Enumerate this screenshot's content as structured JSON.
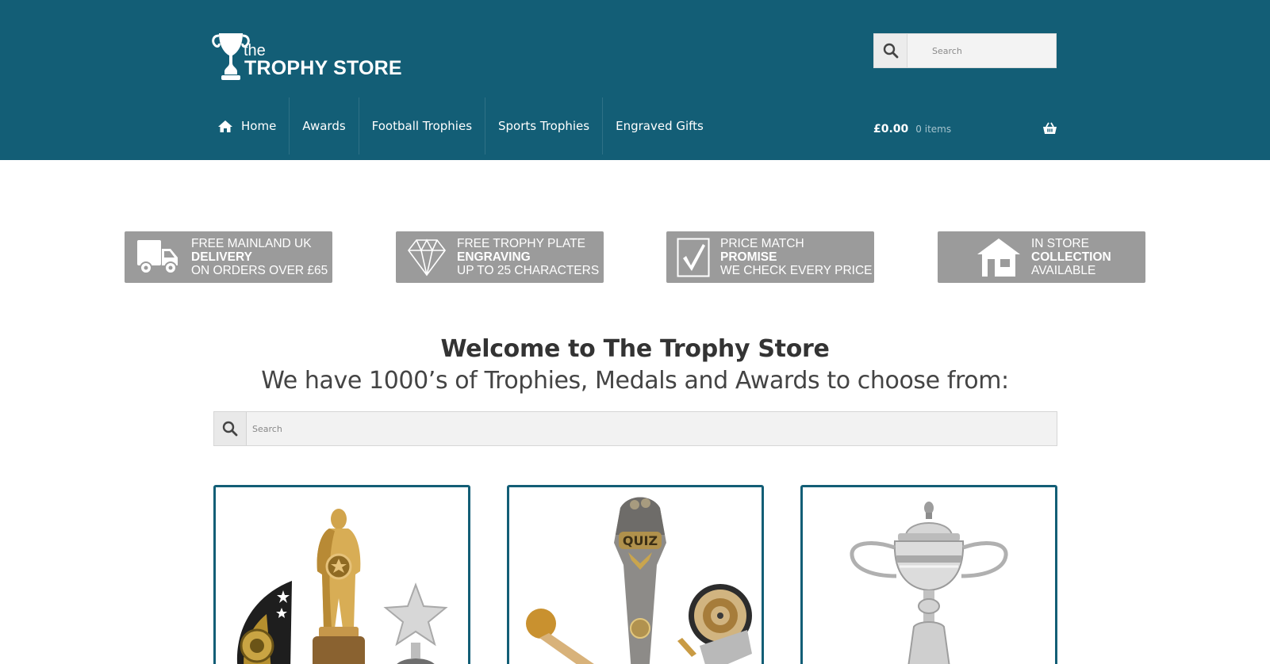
{
  "brand": {
    "logo_the": "the",
    "logo_store": "TROPHY STORE",
    "header_color": "#135e76"
  },
  "header_search": {
    "placeholder": "Search",
    "icon": "search-icon"
  },
  "nav": {
    "home": "Home",
    "awards": "Awards",
    "football": "Football Trophies",
    "sports": "Sports Trophies",
    "engraved": "Engraved Gifts"
  },
  "cart": {
    "total": "£0.00",
    "count": "0 items",
    "icon": "basket-icon"
  },
  "usp": [
    {
      "icon": "truck-icon",
      "line1": "FREE MAINLAND UK",
      "line2": "DELIVERY",
      "line3": "ON ORDERS OVER £65"
    },
    {
      "icon": "diamond-icon",
      "line1": "FREE TROPHY PLATE",
      "line2": "ENGRAVING",
      "line3": "UP TO 25 CHARACTERS"
    },
    {
      "icon": "checkmark-icon",
      "line1": "PRICE MATCH",
      "line2": "PROMISE",
      "line3": "WE CHECK EVERY PRICE"
    },
    {
      "icon": "store-icon",
      "line1": "IN STORE",
      "line2": "COLLECTION",
      "line3": "AVAILABLE"
    }
  ],
  "welcome": {
    "title": "Welcome to The Trophy Store",
    "subtitle": "We have 1000’s of Trophies, Medals and Awards to choose from:"
  },
  "main_search": {
    "placeholder": "Search",
    "icon": "search-icon"
  },
  "categories": [
    {
      "image": "awards-trophies-image"
    },
    {
      "image": "quiz-darts-trophies-image"
    },
    {
      "image": "silver-cup-trophy-image"
    }
  ]
}
